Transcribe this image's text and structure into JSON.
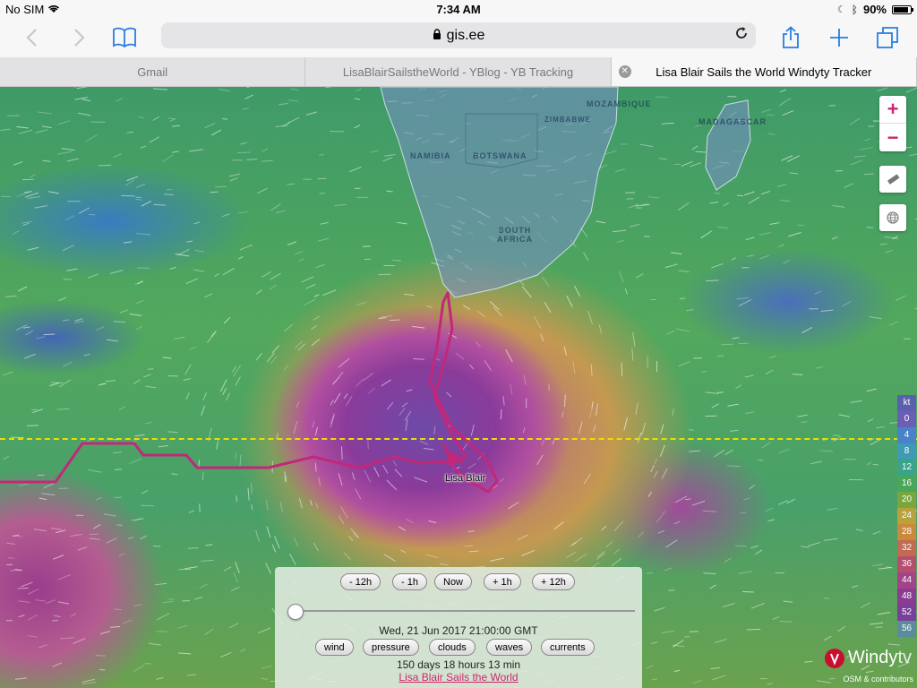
{
  "status": {
    "carrier": "No SIM",
    "time": "7:34 AM",
    "battery": "90%",
    "battery_level": 0.9
  },
  "toolbar": {
    "url": "gis.ee"
  },
  "tabs": [
    {
      "label": "Gmail"
    },
    {
      "label": "LisaBlairSailstheWorld - YBlog - YB Tracking"
    },
    {
      "label": "Lisa Blair Sails the World Windyty Tracker"
    }
  ],
  "map": {
    "labels": [
      "MOZAMBIQUE",
      "ZIMBABWE",
      "NAMIBIA",
      "BOTSWANA",
      "SOUTH AFRICA",
      "MADAGASCAR"
    ],
    "boat_label": "Lisa Blair",
    "zoom_in": "+",
    "zoom_out": "−"
  },
  "legend": {
    "unit": "kt",
    "values": [
      "0",
      "4",
      "8",
      "12",
      "16",
      "20",
      "24",
      "28",
      "32",
      "36",
      "44",
      "48",
      "52",
      "56"
    ],
    "colors": [
      "#6b5fb5",
      "#4a82c7",
      "#3f9ab5",
      "#3aa38a",
      "#4aa65a",
      "#7aa63e",
      "#b8a23c",
      "#c98a3e",
      "#c26a52",
      "#b54f6e",
      "#a34388",
      "#8a3c93",
      "#7a3f9c",
      "#5a8c9c"
    ]
  },
  "time_panel": {
    "buttons": [
      "- 12h",
      "- 1h",
      "Now",
      "+ 1h",
      "+ 12h"
    ],
    "datetime": "Wed, 21 Jun 2017 21:00:00 GMT",
    "layers": [
      "wind",
      "pressure",
      "clouds",
      "waves",
      "currents"
    ],
    "elapsed": "150 days 18 hours 13 min",
    "link": "Lisa Blair Sails the World",
    "slider_position": 0.0
  },
  "branding": {
    "logo": "Windy",
    "logo_suffix": "tv",
    "credits": "OSM & contributors"
  },
  "colors": {
    "accent": "#d0246e",
    "ios_blue": "#2a7de1",
    "track": "#c2287a"
  }
}
